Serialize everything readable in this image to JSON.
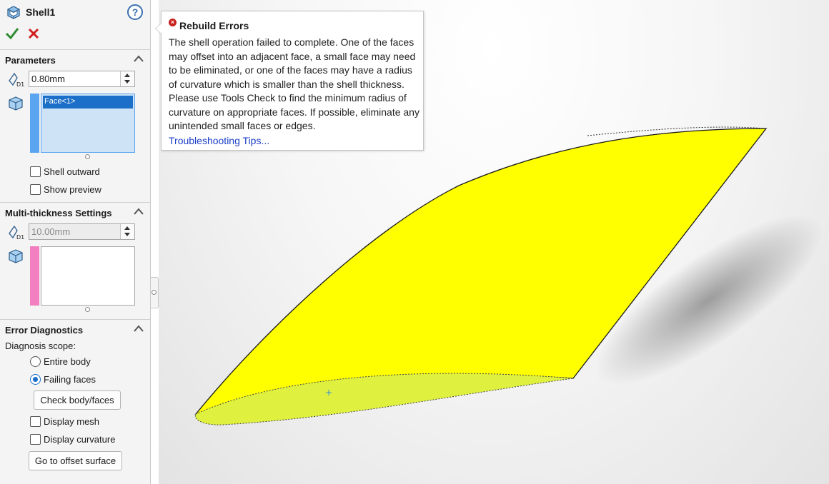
{
  "header": {
    "title": "Shell1",
    "help_icon": "help-icon",
    "ok_icon": "check-icon",
    "cancel_icon": "close-icon"
  },
  "parameters": {
    "label": "Parameters",
    "thickness_value": "0.80mm",
    "faces": [
      "Face<1>"
    ],
    "shell_outward_label": "Shell outward",
    "show_preview_label": "Show preview"
  },
  "multi_thickness": {
    "label": "Multi-thickness Settings",
    "thickness_value": "10.00mm"
  },
  "error_diagnostics": {
    "label": "Error Diagnostics",
    "scope_label": "Diagnosis scope:",
    "scope_options": [
      "Entire body",
      "Failing faces"
    ],
    "scope_selected": "Failing faces",
    "check_button": "Check body/faces",
    "display_mesh_label": "Display mesh",
    "display_curvature_label": "Display curvature",
    "offset_button": "Go to offset surface"
  },
  "tooltip": {
    "title": "Rebuild Errors",
    "body": "The shell operation failed to complete. One of the faces may offset into an adjacent face, a small face may need to be eliminated, or one of the faces may have a radius of curvature which is smaller than the shell thickness. Please use Tools Check to find the minimum radius of curvature on appropriate faces. If possible, eliminate any unintended small faces or edges.",
    "link": "Troubleshooting Tips..."
  },
  "colors": {
    "face_highlight": "#ffff00",
    "end_face": "#dff03e",
    "accent": "#1c6fc8",
    "error": "#c8201c",
    "strip_primary": "#5aa4f0",
    "strip_multi": "#f27fbf"
  }
}
